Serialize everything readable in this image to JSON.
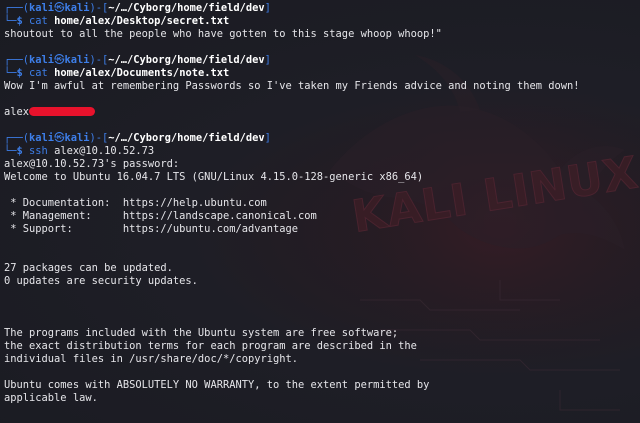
{
  "prompt": {
    "user": "kali",
    "host": "kali",
    "path": "~/…/Cyborg/home/field/dev"
  },
  "blocks": [
    {
      "command": "cat",
      "args": "home/alex/Desktop/secret.txt",
      "output": [
        "shoutout to all the people who have gotten to this stage whoop whoop!\""
      ]
    },
    {
      "command": "cat",
      "args": "home/alex/Documents/note.txt",
      "output": [
        "Wow I'm awful at remembering Passwords so I've taken my Friends advice and noting them down!"
      ]
    }
  ],
  "note_user": "alex",
  "ssh_block": {
    "command": "ssh",
    "args": "alex@10.10.52.73",
    "output": [
      "alex@10.10.52.73's password:",
      "Welcome to Ubuntu 16.04.7 LTS (GNU/Linux 4.15.0-128-generic x86_64)",
      "",
      " * Documentation:  https://help.ubuntu.com",
      " * Management:     https://landscape.canonical.com",
      " * Support:        https://ubuntu.com/advantage",
      "",
      "",
      "27 packages can be updated.",
      "0 updates are security updates.",
      "",
      "",
      "",
      "The programs included with the Ubuntu system are free software;",
      "the exact distribution terms for each program are described in the",
      "individual files in /usr/share/doc/*/copyright.",
      "",
      "Ubuntu comes with ABSOLUTELY NO WARRANTY, to the extent permitted by",
      "applicable law."
    ]
  },
  "colors": {
    "prompt": "#3d7ee8",
    "redaction": "#e8122c",
    "background": "#1c1e26"
  },
  "icons": {
    "kali-skull": "㉿",
    "wallpaper": "kali-dragon-wallpaper"
  },
  "wallpaper_text": "KALI LINUX"
}
